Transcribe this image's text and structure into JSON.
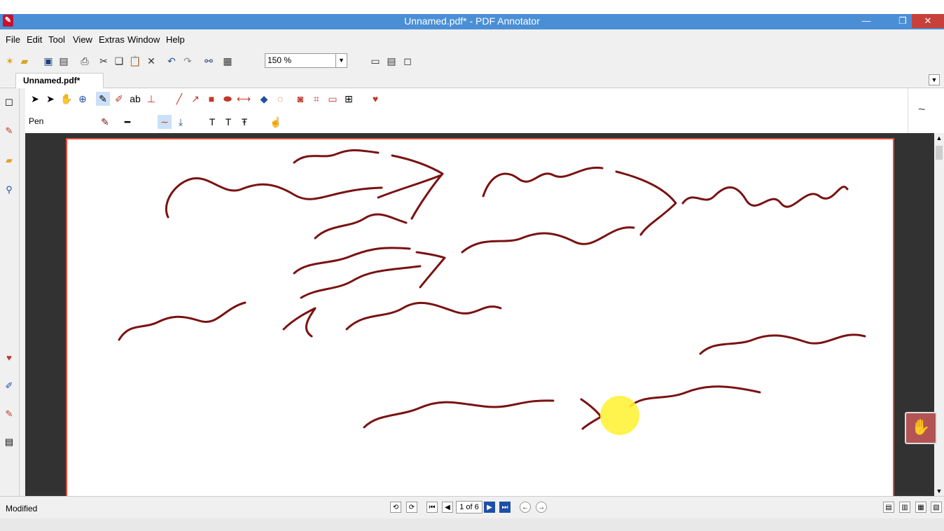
{
  "window": {
    "title": "Unnamed.pdf* - PDF Annotator"
  },
  "menu": [
    "File",
    "Edit",
    "Tool",
    "View",
    "Extras",
    "Window",
    "Help"
  ],
  "toolbar": {
    "zoom_value": "150 %"
  },
  "tab": {
    "label": "Unnamed.pdf*"
  },
  "annotation": {
    "tool_label": "Pen"
  },
  "status": {
    "text": "Modified",
    "page_indicator": "1 of 6"
  },
  "colors": {
    "ink": "#7a1212",
    "accent": "#4a8fd6",
    "page_border": "#e34a3c",
    "highlight": "#fff23a"
  },
  "icons": [
    "app-icon",
    "new-icon",
    "open-icon",
    "save-icon",
    "print-icon",
    "cut-icon",
    "copy-icon",
    "paste-icon",
    "delete-icon",
    "undo-icon",
    "redo-icon",
    "binoculars-icon",
    "zoom-out-icon",
    "zoom-in-icon",
    "pen-icon",
    "highlighter-icon",
    "hand-icon",
    "heart-icon"
  ]
}
